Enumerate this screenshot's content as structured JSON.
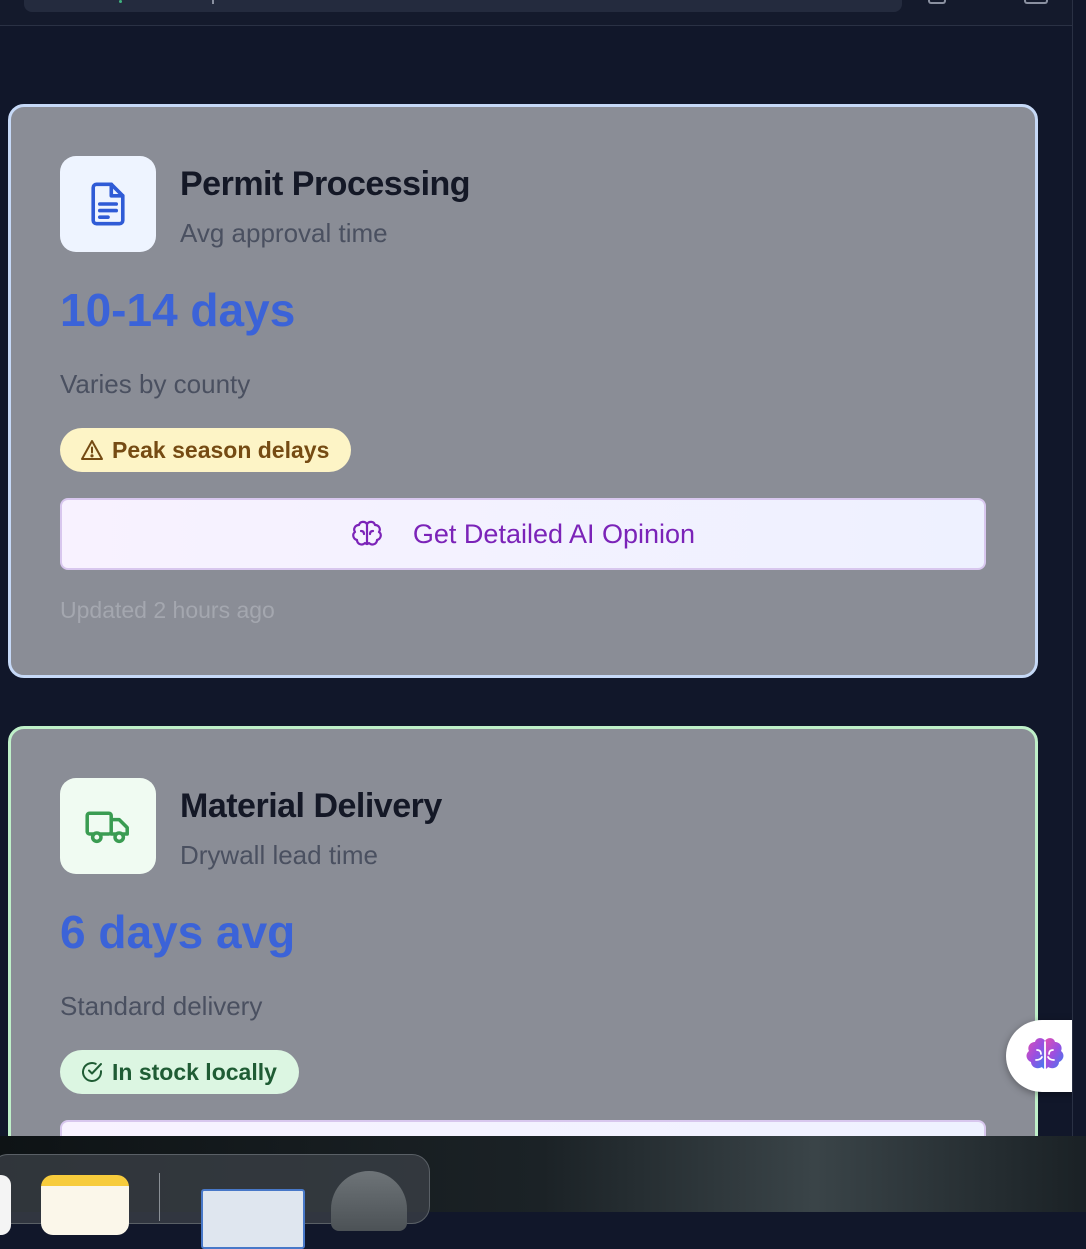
{
  "cards": [
    {
      "title": "Permit Processing",
      "subtitle": "Avg approval time",
      "metric": "10-14 days",
      "note": "Varies by county",
      "badge": "Peak season delays",
      "badge_icon": "warning-triangle-icon",
      "button_label": "Get Detailed AI Opinion",
      "updated": "Updated 2 hours ago",
      "icon": "document-icon",
      "accent": "#3b63d8"
    },
    {
      "title": "Material Delivery",
      "subtitle": "Drywall lead time",
      "metric": "6 days avg",
      "note": "Standard delivery",
      "badge": "In stock locally",
      "badge_icon": "check-circle-icon",
      "icon": "truck-icon",
      "accent": "#3b63d8"
    }
  ],
  "floating_button": {
    "icon": "brain-icon"
  },
  "colors": {
    "metric": "#3b63d8",
    "ai_button_text": "#7b23b8",
    "warn_badge_bg": "#fdf4c6",
    "ok_badge_bg": "#dcf6e2"
  }
}
